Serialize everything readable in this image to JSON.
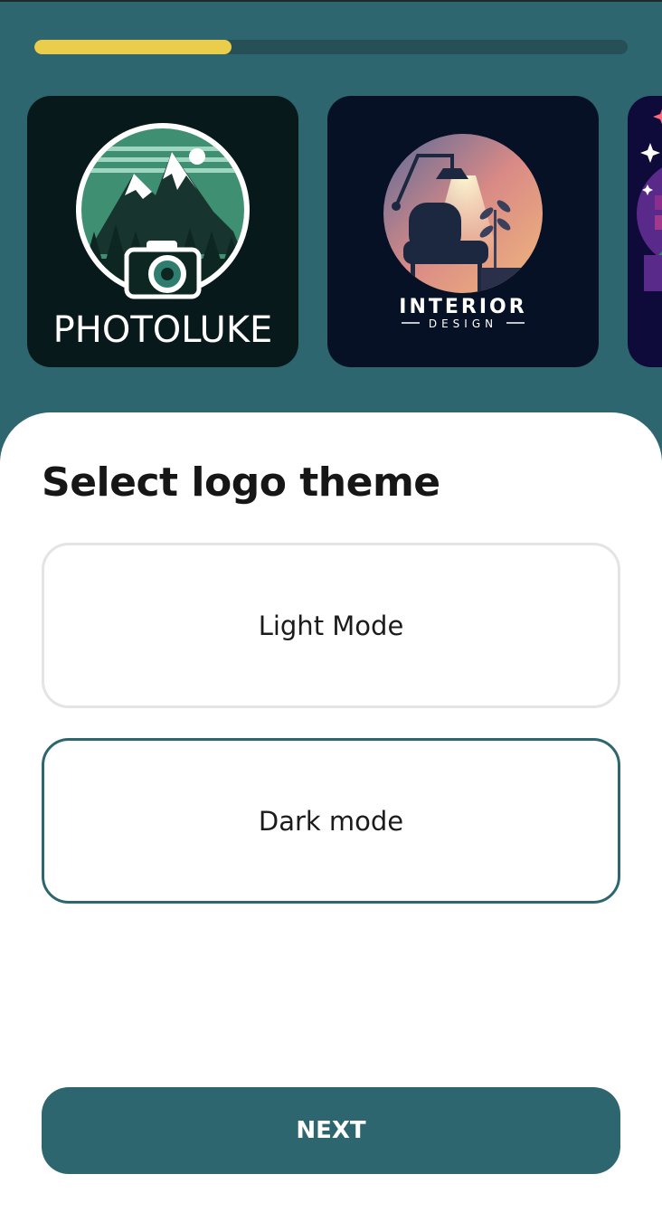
{
  "progress": {
    "fraction": 0.333
  },
  "colors": {
    "background": "#2e6670",
    "progress_fill": "#e9cd4b",
    "accent": "#2e6670",
    "option_border": "#e4e4e4"
  },
  "carousel": {
    "logos": [
      {
        "name": "photoluke-logo",
        "text": "PHOTOLUKE"
      },
      {
        "name": "interior-design-logo",
        "text": "INTERIOR",
        "subtext": "DESIGN"
      },
      {
        "name": "partial-logo"
      }
    ]
  },
  "sheet": {
    "title": "Select logo theme",
    "options": [
      {
        "label": "Light Mode",
        "selected": false
      },
      {
        "label": "Dark mode",
        "selected": true
      }
    ],
    "next_label": "NEXT"
  }
}
